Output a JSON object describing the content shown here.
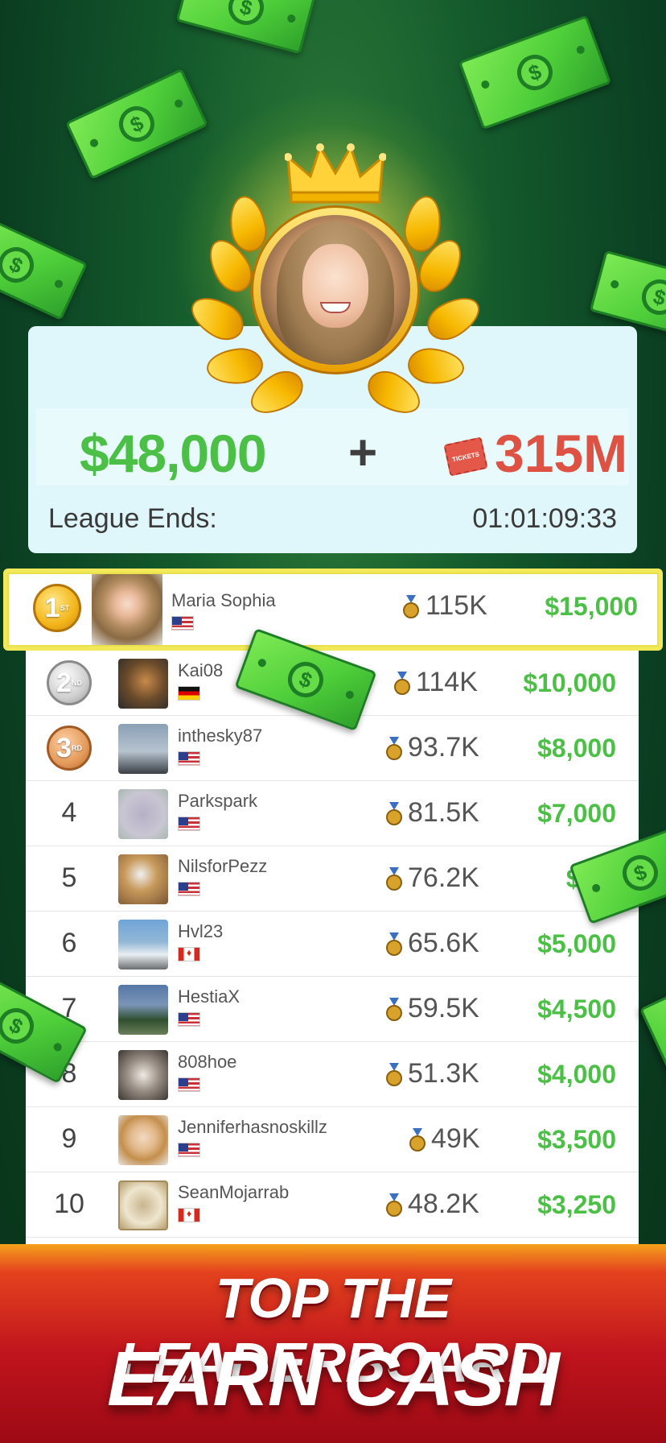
{
  "colors": {
    "accent_green": "#4cc046",
    "tickets_red": "#dd5242",
    "highlight_yellow": "#f2e95a",
    "banner_red": "#c0141d"
  },
  "header": {
    "cash_prize": "$48,000",
    "plus": "+",
    "ticket_icon_label": "TICKETS",
    "tickets_prize": "315M",
    "league_label": "League Ends:",
    "league_timer": "01:01:09:33"
  },
  "leaderboard": [
    {
      "rank": "1",
      "medal": "gold",
      "suffix": "ST",
      "name": "Maria Sophia",
      "flag": "us",
      "score": "115K",
      "prize": "$15,000"
    },
    {
      "rank": "2",
      "medal": "silver",
      "suffix": "ND",
      "name": "Kai08",
      "flag": "de",
      "score": "114K",
      "prize": "$10,000"
    },
    {
      "rank": "3",
      "medal": "bronze",
      "suffix": "RD",
      "name": "inthesky87",
      "flag": "us",
      "score": "93.7K",
      "prize": "$8,000"
    },
    {
      "rank": "4",
      "name": "Parkspark",
      "flag": "us",
      "score": "81.5K",
      "prize": "$7,000"
    },
    {
      "rank": "5",
      "name": "NilsforPezz",
      "flag": "us",
      "score": "76.2K",
      "prize": "$5,5"
    },
    {
      "rank": "6",
      "name": "Hvl23",
      "flag": "ca",
      "score": "65.6K",
      "prize": "$5,000"
    },
    {
      "rank": "7",
      "name": "HestiaX",
      "flag": "us",
      "score": "59.5K",
      "prize": "$4,500"
    },
    {
      "rank": "8",
      "name": "808hoe",
      "flag": "us",
      "score": "51.3K",
      "prize": "$4,000"
    },
    {
      "rank": "9",
      "name": "Jenniferhasnoskillz",
      "flag": "us",
      "score": "49K",
      "prize": "$3,500"
    },
    {
      "rank": "10",
      "name": "SeanMojarrab",
      "flag": "ca",
      "score": "48.2K",
      "prize": "$3,250"
    }
  ],
  "banner": {
    "line1": "TOP THE LEADERBOARD",
    "line2": "EARN CASH"
  },
  "icons": {
    "crown": "crown-icon",
    "laurel": "laurel-wreath-icon",
    "ticket": "ticket-icon",
    "medal": "medal-icon",
    "bill": "dollar-bill-icon"
  }
}
